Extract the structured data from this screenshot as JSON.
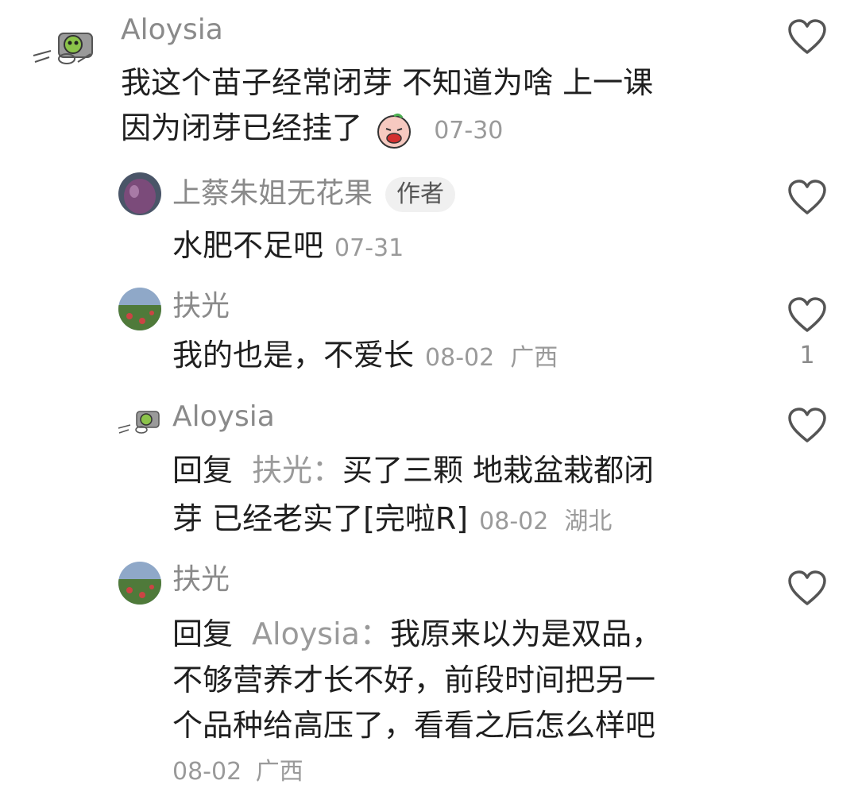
{
  "comments": [
    {
      "user": "Aloysia",
      "text_line1": "我这个苗子经常闭芽 不知道为啥 上一课",
      "text_line2": "因为闭芽已经挂了",
      "emoji_icon": "crying-face-sticker-icon",
      "date": "07-30",
      "heart_icon": "heart-outline-icon"
    },
    {
      "user": "上蔡朱姐无花果",
      "badge": "作者",
      "text": "水肥不足吧",
      "date": "07-31",
      "heart_icon": "heart-outline-icon"
    },
    {
      "user": "扶光",
      "text": "我的也是，不爱长",
      "date": "08-02",
      "location": "广西",
      "likes": "1",
      "heart_icon": "heart-outline-icon"
    },
    {
      "user": "Aloysia",
      "reply_label": "回复",
      "reply_to": "扶光：",
      "text_line1": "买了三颗 地栽盆栽都闭",
      "text_line2": "芽 已经老实了[完啦R]",
      "date": "08-02",
      "location": "湖北",
      "heart_icon": "heart-outline-icon"
    },
    {
      "user": "扶光",
      "reply_label": "回复",
      "reply_to": "Aloysia：",
      "text_line1": "我原来以为是双品，",
      "text_line2": "不够营养才长不好，前段时间把另一",
      "text_line3": "个品种给高压了，看看之后怎么样吧",
      "date": "08-02",
      "location": "广西",
      "heart_icon": "heart-outline-icon"
    }
  ]
}
